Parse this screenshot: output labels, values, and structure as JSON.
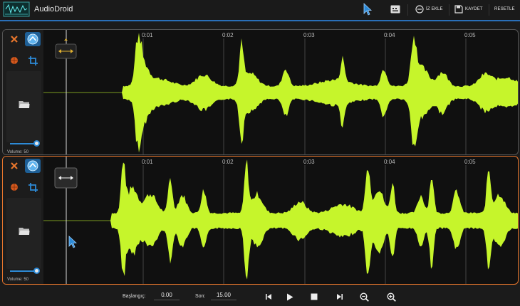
{
  "app": {
    "title": "AudioDroid"
  },
  "toolbar": {
    "add_track_label": "İZ EKLE",
    "save_label": "KAYDET",
    "reset_label": "RESETLE"
  },
  "time_ticks": [
    "0:01",
    "0:02",
    "0:03",
    "0:04",
    "0:05"
  ],
  "tracks": [
    {
      "volume_label": "Volume: 50",
      "volume_value": 50,
      "selected": false
    },
    {
      "volume_label": "Volume: 50",
      "volume_value": 50,
      "selected": true
    }
  ],
  "bottom": {
    "start_label": "Başlangıç:",
    "start_value": "0.00",
    "end_label": "Son:",
    "end_value": "15.00"
  },
  "colors": {
    "accent": "#2a6fb8",
    "waveform": "#c6f52b",
    "selected_border": "#e8762c",
    "close": "#e8762c"
  },
  "icons": [
    "pointer-icon",
    "keyboard-icon",
    "add-track-icon",
    "save-icon",
    "close-icon",
    "waveform-icon",
    "record-icon",
    "crop-icon",
    "folder-icon",
    "move-handle-icon",
    "skip-back-icon",
    "play-icon",
    "stop-icon",
    "skip-forward-icon",
    "zoom-out-icon",
    "zoom-in-icon"
  ]
}
